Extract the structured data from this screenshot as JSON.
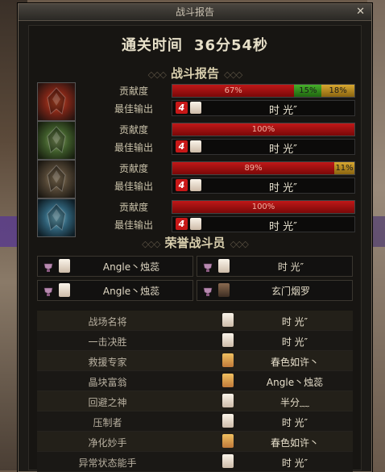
{
  "window": {
    "title": "战斗报告",
    "close_glyph": "✕"
  },
  "clear_time": {
    "label": "通关时间",
    "value": "36分54秒"
  },
  "section_battle": {
    "title": "战斗报告",
    "dec": "◇◇◇"
  },
  "players": [
    {
      "contribution_label": "贡献度",
      "best_output_label": "最佳输出",
      "segments": [
        {
          "text": "67%",
          "pct": 67,
          "color": "red"
        },
        {
          "text": "15%",
          "pct": 15,
          "color": "green"
        },
        {
          "text": "18%",
          "pct": 18,
          "color": "gold"
        }
      ],
      "rank_icon": "4",
      "best_name": "时 光″"
    },
    {
      "contribution_label": "贡献度",
      "best_output_label": "最佳输出",
      "segments": [
        {
          "text": "100%",
          "pct": 100,
          "color": "red"
        }
      ],
      "rank_icon": "4",
      "best_name": "时 光″"
    },
    {
      "contribution_label": "贡献度",
      "best_output_label": "最佳输出",
      "segments": [
        {
          "text": "89%",
          "pct": 89,
          "color": "red"
        },
        {
          "text": "11%",
          "pct": 11,
          "color": "gold"
        }
      ],
      "rank_icon": "4",
      "best_name": "时 光″"
    },
    {
      "contribution_label": "贡献度",
      "best_output_label": "最佳输出",
      "segments": [
        {
          "text": "100%",
          "pct": 100,
          "color": "red"
        }
      ],
      "rank_icon": "4",
      "best_name": "时 光″"
    }
  ],
  "section_honor": {
    "title": "荣誉战斗员",
    "dec": "◇◇◇"
  },
  "honor": [
    {
      "name": "Angle丶烛蕊",
      "avatar": "white"
    },
    {
      "name": "时 光″",
      "avatar": "white"
    },
    {
      "name": "Angle丶烛蕊",
      "avatar": "white"
    },
    {
      "name": "玄门烟罗",
      "avatar": "dark"
    }
  ],
  "awards": [
    {
      "title": "战场名将",
      "name": "时 光″",
      "avatar": "white"
    },
    {
      "title": "一击决胜",
      "name": "时 光″",
      "avatar": "white"
    },
    {
      "title": "救援专家",
      "name": "春色如许丶",
      "avatar": "blonde"
    },
    {
      "title": "晶块富翁",
      "name": "Angle丶烛蕊",
      "avatar": "blonde"
    },
    {
      "title": "回避之神",
      "name": "半分﹏",
      "avatar": "white"
    },
    {
      "title": "压制者",
      "name": "时 光″",
      "avatar": "white"
    },
    {
      "title": "净化妙手",
      "name": "春色如许丶",
      "avatar": "blonde"
    },
    {
      "title": "异常状态能手",
      "name": "时 光″",
      "avatar": "white"
    }
  ],
  "colors": {
    "bar_red": "#c01818",
    "bar_green": "#46b02a",
    "bar_gold": "#d8a830",
    "accent_text": "#d9cfae"
  }
}
